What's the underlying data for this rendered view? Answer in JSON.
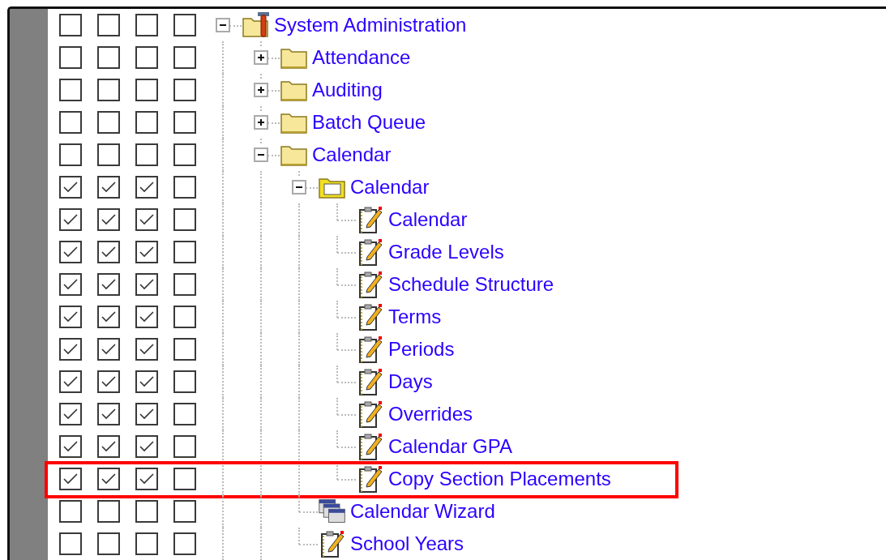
{
  "tree": [
    {
      "label": "System Administration",
      "kind": "tools-folder",
      "expanded": true,
      "permissions": [
        false,
        false,
        false,
        false
      ],
      "highlighted": false,
      "children": [
        {
          "label": "Attendance",
          "kind": "folder",
          "expanded": false,
          "permissions": [
            false,
            false,
            false,
            false
          ],
          "highlighted": false
        },
        {
          "label": "Auditing",
          "kind": "folder",
          "expanded": false,
          "permissions": [
            false,
            false,
            false,
            false
          ],
          "highlighted": false
        },
        {
          "label": "Batch Queue",
          "kind": "folder",
          "expanded": false,
          "permissions": [
            false,
            false,
            false,
            false
          ],
          "highlighted": false
        },
        {
          "label": "Calendar",
          "kind": "folder",
          "expanded": true,
          "permissions": [
            false,
            false,
            false,
            false
          ],
          "highlighted": false,
          "children": [
            {
              "label": "Calendar",
              "kind": "open-folder",
              "expanded": true,
              "permissions": [
                true,
                true,
                true,
                false
              ],
              "highlighted": false,
              "children": [
                {
                  "label": "Calendar",
                  "kind": "page",
                  "permissions": [
                    true,
                    true,
                    true,
                    false
                  ],
                  "highlighted": false
                },
                {
                  "label": "Grade Levels",
                  "kind": "page",
                  "permissions": [
                    true,
                    true,
                    true,
                    false
                  ],
                  "highlighted": false
                },
                {
                  "label": "Schedule Structure",
                  "kind": "page",
                  "permissions": [
                    true,
                    true,
                    true,
                    false
                  ],
                  "highlighted": false
                },
                {
                  "label": "Terms",
                  "kind": "page",
                  "permissions": [
                    true,
                    true,
                    true,
                    false
                  ],
                  "highlighted": false
                },
                {
                  "label": "Periods",
                  "kind": "page",
                  "permissions": [
                    true,
                    true,
                    true,
                    false
                  ],
                  "highlighted": false
                },
                {
                  "label": "Days",
                  "kind": "page",
                  "permissions": [
                    true,
                    true,
                    true,
                    false
                  ],
                  "highlighted": false
                },
                {
                  "label": "Overrides",
                  "kind": "page",
                  "permissions": [
                    true,
                    true,
                    true,
                    false
                  ],
                  "highlighted": false
                },
                {
                  "label": "Calendar GPA",
                  "kind": "page",
                  "permissions": [
                    true,
                    true,
                    true,
                    false
                  ],
                  "highlighted": false
                },
                {
                  "label": "Copy Section Placements",
                  "kind": "page",
                  "permissions": [
                    true,
                    true,
                    true,
                    false
                  ],
                  "highlighted": true
                }
              ]
            },
            {
              "label": "Calendar Wizard",
              "kind": "wizard",
              "permissions": [
                false,
                false,
                false,
                false
              ],
              "highlighted": false
            },
            {
              "label": "School Years",
              "kind": "page",
              "permissions": [
                false,
                false,
                false,
                false
              ],
              "highlighted": false
            }
          ]
        }
      ]
    }
  ]
}
